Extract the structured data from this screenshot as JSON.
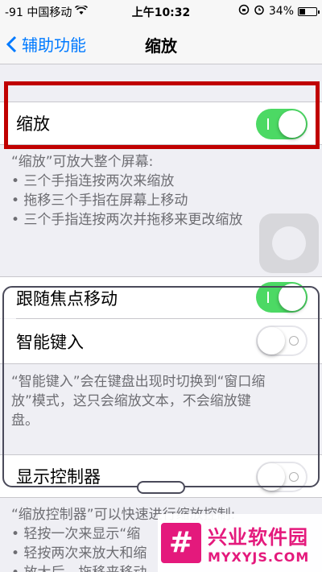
{
  "status_bar": {
    "carrier": "-91 中国移动",
    "time": "上午10:32",
    "battery": "34%",
    "battery_level": 0.34
  },
  "nav": {
    "back_label": "辅助功能",
    "title": "缩放"
  },
  "zoom": {
    "label": "缩放",
    "enabled": true
  },
  "zoom_footer": {
    "heading": "“缩放”可放大整个屏幕:",
    "bullets": [
      "• 三个手指连按两次来缩放",
      "• 拖移三个手指在屏幕上移动",
      "• 三个手指连按两次并拖移来更改缩放"
    ]
  },
  "follow_focus": {
    "label": "跟随焦点移动",
    "enabled": true
  },
  "smart_typing": {
    "label": "智能键入",
    "enabled": false
  },
  "smart_typing_footer": {
    "lines": [
      "“智能键入”会在键盘出现时切换到“窗口缩",
      "放”模式，这只会缩放文本，不会缩放键",
      "盘。"
    ]
  },
  "show_controller": {
    "label": "显示控制器",
    "enabled": false
  },
  "controller_footer": {
    "lines": [
      "“缩放控制器”可以快速进行缩放控制:",
      "• 轻按一次来显示“缩",
      "• 轻按两次来放大和缩",
      "• 放大后，拖移来移动"
    ]
  },
  "watermark": {
    "logo": "#",
    "title": "兴业软件园",
    "url": "MYXYJS.COM"
  },
  "colors": {
    "accent": "#007aff",
    "switch_on": "#4cd964",
    "highlight": "#c00000",
    "watermark": "#e4197c"
  }
}
